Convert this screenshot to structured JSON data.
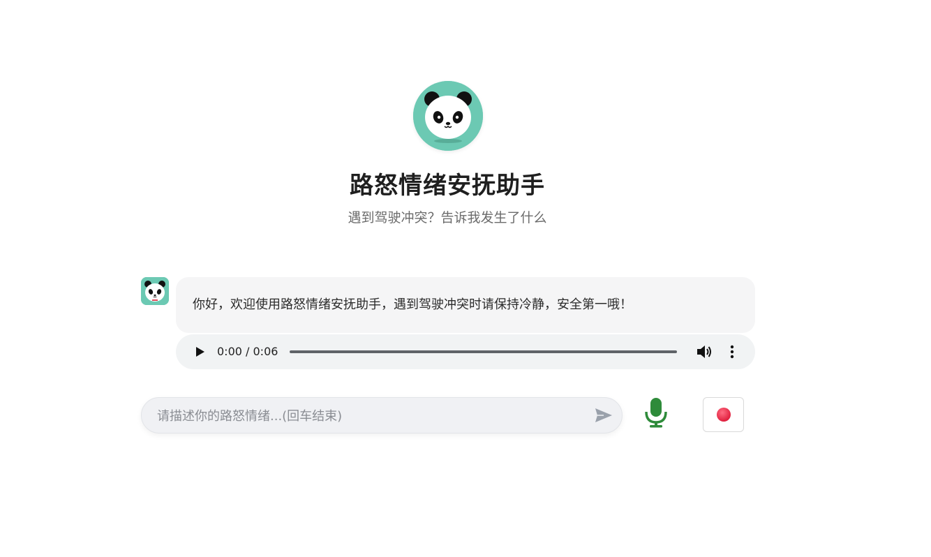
{
  "header": {
    "title": "路怒情绪安抚助手",
    "subtitle": "遇到驾驶冲突？告诉我发生了什么",
    "avatar_icon": "panda-icon"
  },
  "chat": {
    "messages": [
      {
        "role": "assistant",
        "avatar_icon": "panda-icon",
        "text": "你好，欢迎使用路怒情绪安抚助手，遇到驾驶冲突时请保持冷静，安全第一哦！",
        "audio": {
          "time": "0:00 / 0:06",
          "progress": 0
        }
      }
    ]
  },
  "composer": {
    "placeholder": "请描述你的路怒情绪...(回车结束)",
    "value": "",
    "send_icon": "send-icon",
    "mic_icon": "microphone-icon",
    "record_icon": "record-icon"
  },
  "colors": {
    "accent": "#6cc9b3",
    "mic": "#2e8b3a",
    "record": "#e0213f"
  }
}
